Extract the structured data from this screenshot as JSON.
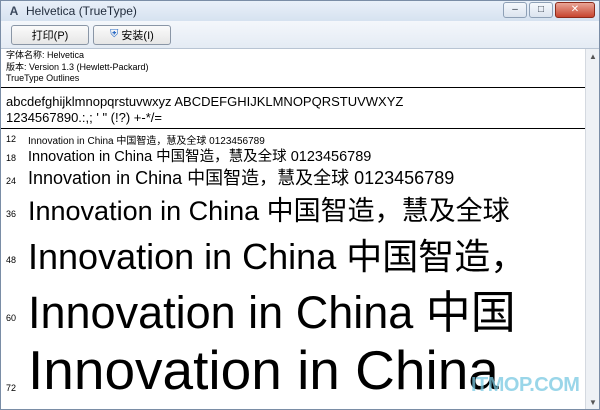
{
  "window": {
    "title": "Helvetica (TrueType)",
    "controls": {
      "minimize": "–",
      "maximize": "□",
      "close": "✕"
    }
  },
  "toolbar": {
    "print_label": "打印(P)",
    "install_label": "安装(I)"
  },
  "font_info": {
    "name_line": "字体名称: Helvetica",
    "version_line": "版本: Version 1.3 (Hewlett-Packard)",
    "type_line": "TrueType Outlines"
  },
  "samples": {
    "alphabet": "abcdefghijklmnopqrstuvwxyz ABCDEFGHIJKLMNOPQRSTUVWXYZ",
    "digits_punct": "1234567890.:,; ' \" (!?) +-*/="
  },
  "size_rows": [
    {
      "size": "12",
      "text": "Innovation in China 中国智造，慧及全球 0123456789"
    },
    {
      "size": "18",
      "text": "Innovation in China 中国智造，慧及全球 0123456789"
    },
    {
      "size": "24",
      "text": "Innovation in China 中国智造，慧及全球 0123456789"
    },
    {
      "size": "36",
      "text": "Innovation in China 中国智造，慧及全球"
    },
    {
      "size": "48",
      "text": "Innovation in China 中国智造，"
    },
    {
      "size": "60",
      "text": "Innovation in China 中国"
    },
    {
      "size": "72",
      "text": "Innovation in China"
    }
  ],
  "watermark": "ITMOP.COM",
  "colors": {
    "titlebar": "#dfe8f3",
    "close_button": "#c7452f",
    "watermark": "#78c8e1"
  }
}
